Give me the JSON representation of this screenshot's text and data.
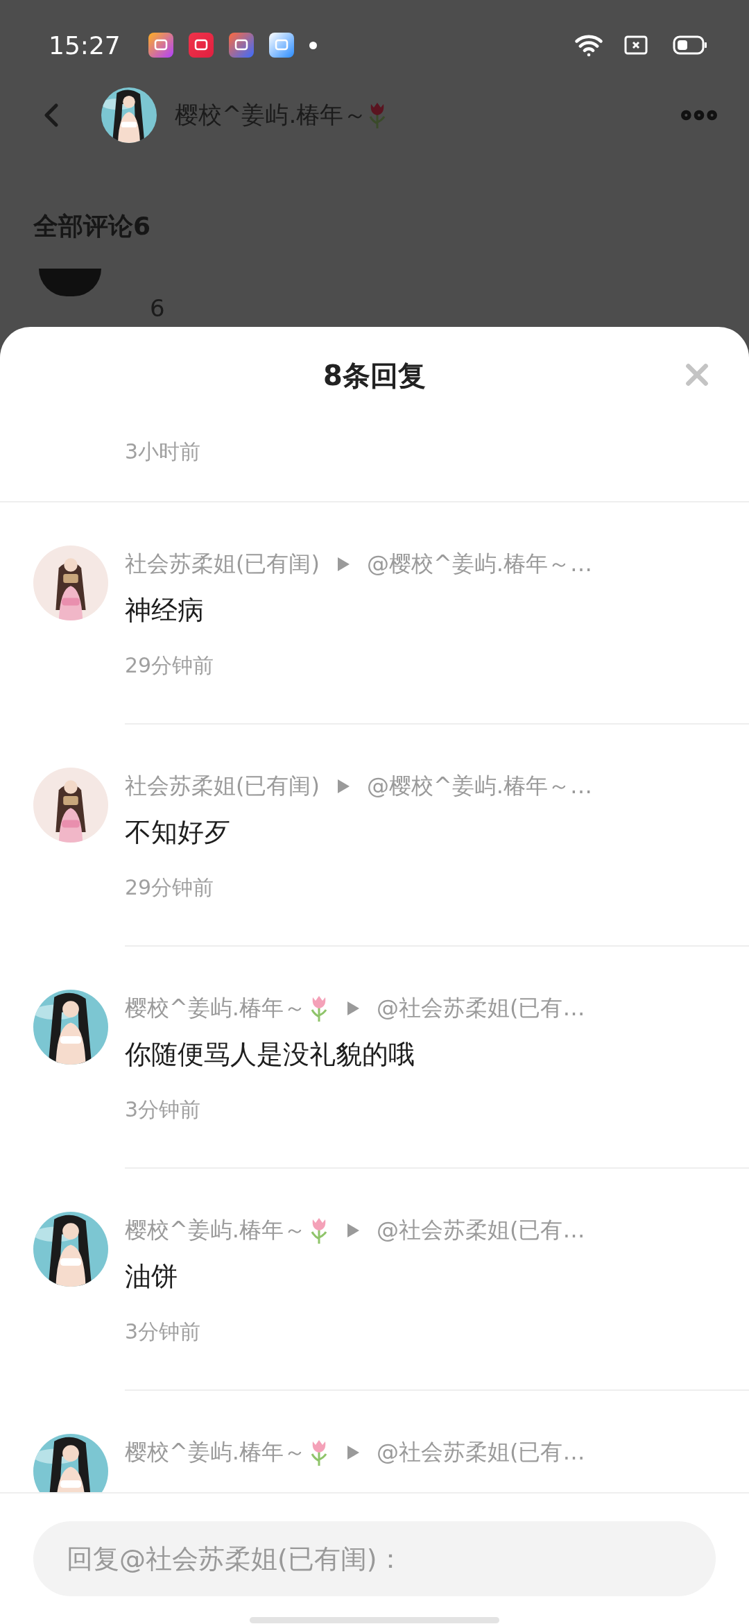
{
  "status_bar": {
    "time": "15:27"
  },
  "header": {
    "title": "樱校^姜屿.椿年～",
    "flower": true
  },
  "comments": {
    "title": "全部评论6",
    "preview_count": "6"
  },
  "sheet": {
    "title": "8条回复",
    "earlier_time": "3小时前",
    "replies": [
      {
        "author": "社会苏柔姐(已有闺)",
        "flower": false,
        "target": "@樱校^姜屿.椿年～…",
        "content": "神经病",
        "time": "29分钟前"
      },
      {
        "author": "社会苏柔姐(已有闺)",
        "flower": false,
        "target": "@樱校^姜屿.椿年～…",
        "content": "不知好歹",
        "time": "29分钟前"
      },
      {
        "author": "樱校^姜屿.椿年～",
        "flower": true,
        "target": "@社会苏柔姐(已有…",
        "content": "你随便骂人是没礼貌的哦",
        "time": "3分钟前"
      },
      {
        "author": "樱校^姜屿.椿年～",
        "flower": true,
        "target": "@社会苏柔姐(已有…",
        "content": "油饼",
        "time": "3分钟前"
      },
      {
        "author": "樱校^姜屿.椿年～",
        "flower": true,
        "target": "@社会苏柔姐(已有…"
      }
    ],
    "input": {
      "placeholder": "回复@社会苏柔姐(已有闺)："
    }
  }
}
